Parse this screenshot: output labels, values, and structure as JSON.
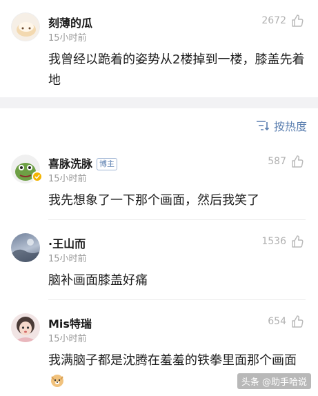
{
  "comments": [
    {
      "username": "刻薄的瓜",
      "time": "15小时前",
      "likes": "2672",
      "text": "我曾经以跪着的姿势从2楼掉到一楼，膝盖先着地"
    },
    {
      "username": "喜脉洗脉",
      "badge": "博主",
      "time": "15小时前",
      "likes": "587",
      "text": "我先想象了一下那个画面，然后我笑了"
    },
    {
      "username": "·王山而",
      "time": "15小时前",
      "likes": "1536",
      "text": "脑补画面膝盖好痛"
    },
    {
      "username": "Mis特瑞",
      "time": "15小时前",
      "likes": "654",
      "text": "我满脑子都是沈腾在羞羞的铁拳里面那个画面"
    }
  ],
  "sort": {
    "label": "按热度"
  },
  "watermark": "头条 @助手哈说",
  "colors": {
    "accent": "#5b7fb0",
    "muted": "#9a9a9a",
    "band": "#f2f2f4"
  }
}
